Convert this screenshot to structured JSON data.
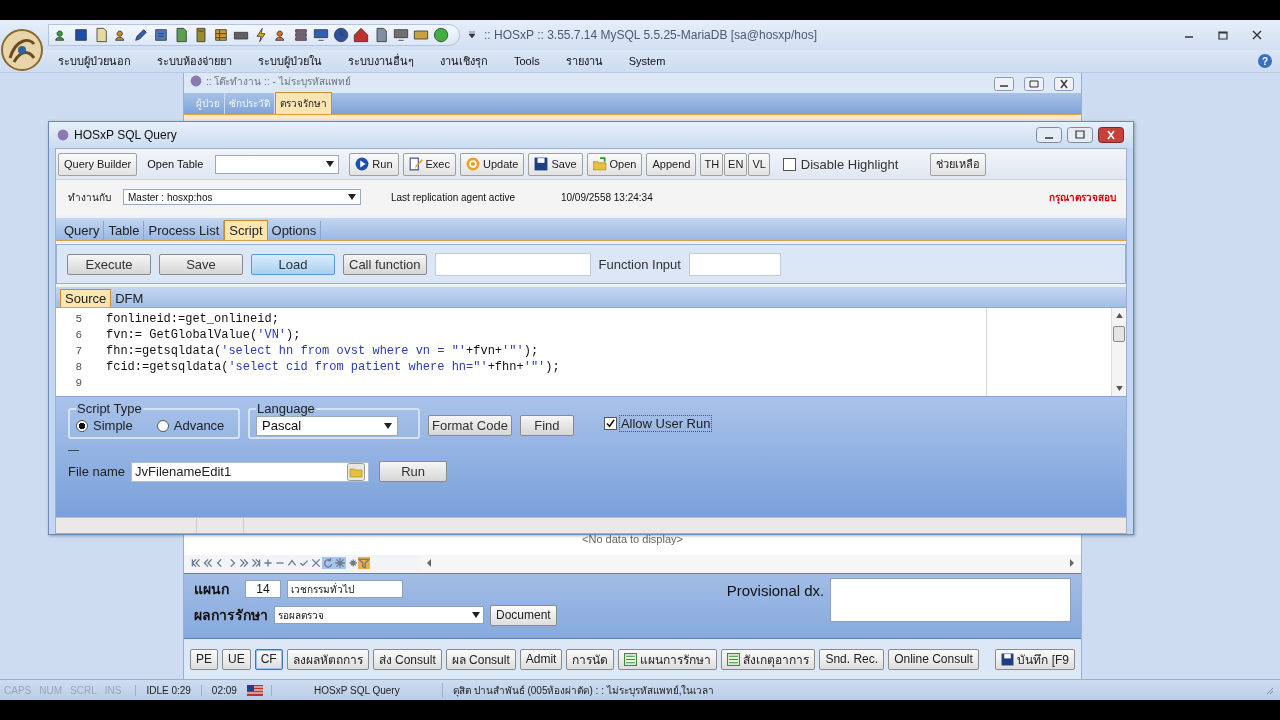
{
  "app": {
    "title": ":: HOSxP :: 3.55.7.14 MySQL 5.5.25-MariaDB [sa@hosxp/hos]",
    "help": "?"
  },
  "menu": [
    "ระบบผู้ป่วยนอก",
    "ระบบห้องจ่ายยา",
    "ระบบผู้ป่วยใน",
    "ระบบงานอื่นๆ",
    "งานเชิงรุก",
    "Tools",
    "รายงาน",
    "System"
  ],
  "desk_window": {
    "title": ":: โต๊ะทำงาน :: - ไม่ระบุรหัสแพทย์",
    "tabs": [
      {
        "label": "ผู้ป่วย",
        "selected": false
      },
      {
        "label": "ซักประวัติ",
        "selected": false
      },
      {
        "label": "ตรวจรักษา",
        "selected": true
      }
    ],
    "grid_empty": "<No data to display>",
    "department_label": "แผนก",
    "department_code": "14",
    "department_name": "เวชกรรมทั่วไป",
    "result_label": "ผลการรักษา",
    "result_value": "รอผลตรวจ",
    "document_button": "Document",
    "dx_label": "Provisional dx.",
    "buttons": [
      {
        "label": "PE",
        "kind": "button",
        "focused": false
      },
      {
        "label": "UE",
        "kind": "button",
        "focused": false
      },
      {
        "label": "CF",
        "kind": "button",
        "focused": true
      },
      {
        "label": "ลงผลหัตถการ",
        "kind": "button",
        "focused": false
      },
      {
        "label": "ส่ง Consult",
        "kind": "button",
        "focused": false
      },
      {
        "label": "ผล Consult",
        "kind": "button",
        "focused": false
      },
      {
        "label": "Admit",
        "kind": "button",
        "focused": false
      },
      {
        "label": "การนัด",
        "kind": "button",
        "focused": false
      },
      {
        "label": "แผนการรักษา",
        "kind": "list",
        "focused": false
      },
      {
        "label": "สังเกตุอาการ",
        "kind": "list",
        "focused": false
      },
      {
        "label": "Snd. Rec.",
        "kind": "button",
        "focused": false
      },
      {
        "label": "Online Consult",
        "kind": "button",
        "focused": false
      },
      {
        "label": "บันทึก [F9",
        "kind": "save",
        "focused": false
      }
    ]
  },
  "query_window": {
    "title": "HOSxP SQL Query",
    "toolbar": [
      {
        "kind": "button",
        "label": "Query Builder"
      },
      {
        "kind": "label",
        "label": "Open Table"
      },
      {
        "kind": "combo"
      },
      {
        "kind": "run",
        "label": "Run"
      },
      {
        "kind": "exec",
        "label": "Exec"
      },
      {
        "kind": "update",
        "label": "Update"
      },
      {
        "kind": "save",
        "label": "Save"
      },
      {
        "kind": "open",
        "label": "Open"
      },
      {
        "kind": "button",
        "label": "Append"
      },
      {
        "kind": "small",
        "label": "TH"
      },
      {
        "kind": "small",
        "label": "EN"
      },
      {
        "kind": "small",
        "label": "VL"
      },
      {
        "kind": "checkbox",
        "label": "Disable Highlight",
        "checked": false
      },
      {
        "kind": "button",
        "label": "ช่วยเหลือ"
      }
    ],
    "connection_label": "ทำงานกับ",
    "connection": "Master : hosxp:hos",
    "replication_label": "Last replication agent active",
    "replication_time": "10/09/2558 13:24:34",
    "warning": "กรุณาตรวจสอบ",
    "tabs": [
      {
        "label": "Query",
        "selected": false
      },
      {
        "label": "Table",
        "selected": false
      },
      {
        "label": "Process List",
        "selected": false
      },
      {
        "label": "Script",
        "selected": true
      },
      {
        "label": "Options",
        "selected": false
      }
    ],
    "script_buttons": [
      {
        "label": "Execute",
        "hot": false
      },
      {
        "label": "Save",
        "hot": false
      },
      {
        "label": "Load",
        "hot": true
      },
      {
        "label": "Call function",
        "hot": false
      }
    ],
    "function_input_label": "Function Input",
    "source_tabs": [
      {
        "label": "Source",
        "selected": true
      },
      {
        "label": "DFM",
        "selected": false
      }
    ],
    "code": [
      {
        "number": "5",
        "parts": [
          {
            "text": "fonlineid:=get_onlineid;",
            "kind": "plain"
          }
        ]
      },
      {
        "number": "6",
        "parts": [
          {
            "text": "fvn:= GetGlobalValue(",
            "kind": "plain"
          },
          {
            "text": "'VN'",
            "kind": "string"
          },
          {
            "text": ");",
            "kind": "plain"
          }
        ]
      },
      {
        "number": "7",
        "parts": [
          {
            "text": "fhn:=getsqldata(",
            "kind": "plain"
          },
          {
            "text": "'select hn from ovst where vn = \"'",
            "kind": "string"
          },
          {
            "text": "+fvn+",
            "kind": "plain"
          },
          {
            "text": "'\"'",
            "kind": "string"
          },
          {
            "text": ");",
            "kind": "plain"
          }
        ]
      },
      {
        "number": "8",
        "parts": [
          {
            "text": "fcid:=getsqldata(",
            "kind": "plain"
          },
          {
            "text": "'select cid from patient where hn=\"'",
            "kind": "string"
          },
          {
            "text": "+fhn+",
            "kind": "plain"
          },
          {
            "text": "'\"'",
            "kind": "string"
          },
          {
            "text": ");",
            "kind": "plain"
          }
        ]
      },
      {
        "number": "9"
      }
    ],
    "script_type": {
      "label": "Script Type",
      "options": [
        {
          "label": "Simple",
          "selected": true
        },
        {
          "label": "Advance",
          "selected": false
        }
      ]
    },
    "language": {
      "label": "Language",
      "value": "Pascal"
    },
    "format_button": "Format Code",
    "find_button": "Find",
    "allow_user_run": {
      "label": "Allow User Run",
      "checked": true
    },
    "dash": "—",
    "file_label": "File name",
    "file_value": "JvFilenameEdit1",
    "run_button": "Run"
  },
  "status_bar": {
    "keys": [
      {
        "label": "CAPS",
        "active": false
      },
      {
        "label": "NUM",
        "active": false
      },
      {
        "label": "SCRL",
        "active": false
      },
      {
        "label": "INS",
        "active": false
      }
    ],
    "idle": "IDLE 0:29",
    "time": "02:09",
    "window": "HOSxP SQL Query",
    "user": "ดุสิต  ปานสำพันธ์ (005ห้องผ่าตัด) : : ไม่ระบุรหัสแพทย์,ในเวลา"
  }
}
